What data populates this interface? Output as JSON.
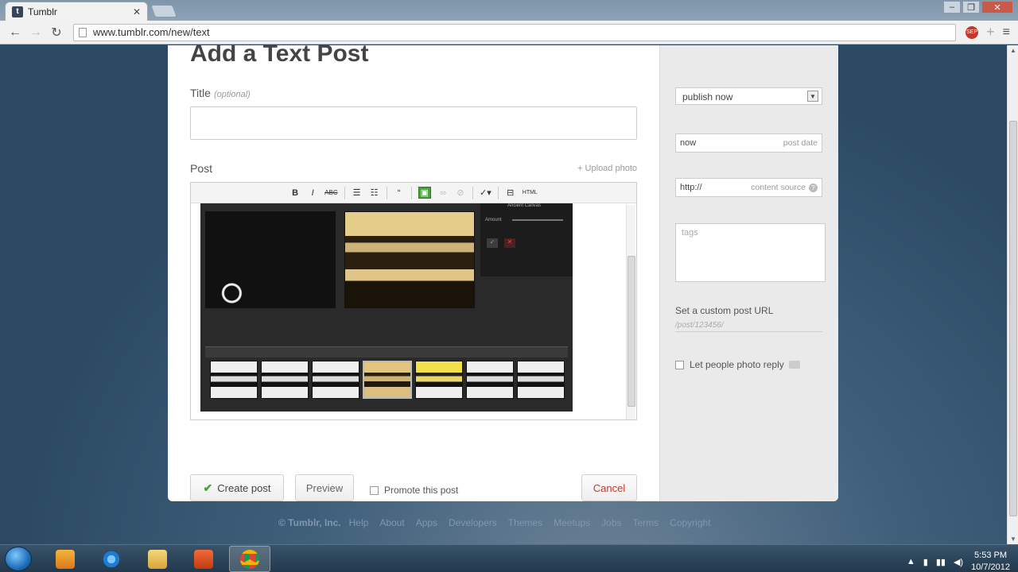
{
  "browser": {
    "tab_title": "Tumblr",
    "tab_favicon": "t",
    "url_host": "www.tumblr.com",
    "url_path": "/new/text",
    "extension_label": "SEP"
  },
  "form": {
    "heading": "Add a Text Post",
    "title_label": "Title",
    "title_optional": "(optional)",
    "title_value": "",
    "post_label": "Post",
    "upload_photo": "+ Upload photo",
    "toolbar": {
      "bold": "B",
      "italic": "I",
      "strike": "ABC",
      "html": "HTML"
    },
    "embedded_image": {
      "panel_title": "Ancient Canvas",
      "panel_label": "Amount"
    }
  },
  "actions": {
    "create": "Create post",
    "preview": "Preview",
    "promote": "Promote this post",
    "cancel": "Cancel"
  },
  "sidebar": {
    "publish_select": "publish now",
    "date_value": "now",
    "date_hint": "post date",
    "source_value": "http://",
    "source_hint": "content source",
    "tags_placeholder": "tags",
    "custom_url_label": "Set a custom post URL",
    "custom_url_placeholder": "/post/123456/",
    "photo_reply": "Let people photo reply"
  },
  "footer": {
    "copyright": "© Tumblr, Inc.",
    "links": [
      "Help",
      "About",
      "Apps",
      "Developers",
      "Themes",
      "Meetups",
      "Jobs",
      "Terms",
      "Copyright"
    ]
  },
  "taskbar": {
    "time": "5:53 PM",
    "date": "10/7/2012"
  },
  "colors": {
    "accent_green": "#3fa534",
    "cancel_red": "#c0392b",
    "page_bg": "#2c4a63"
  }
}
